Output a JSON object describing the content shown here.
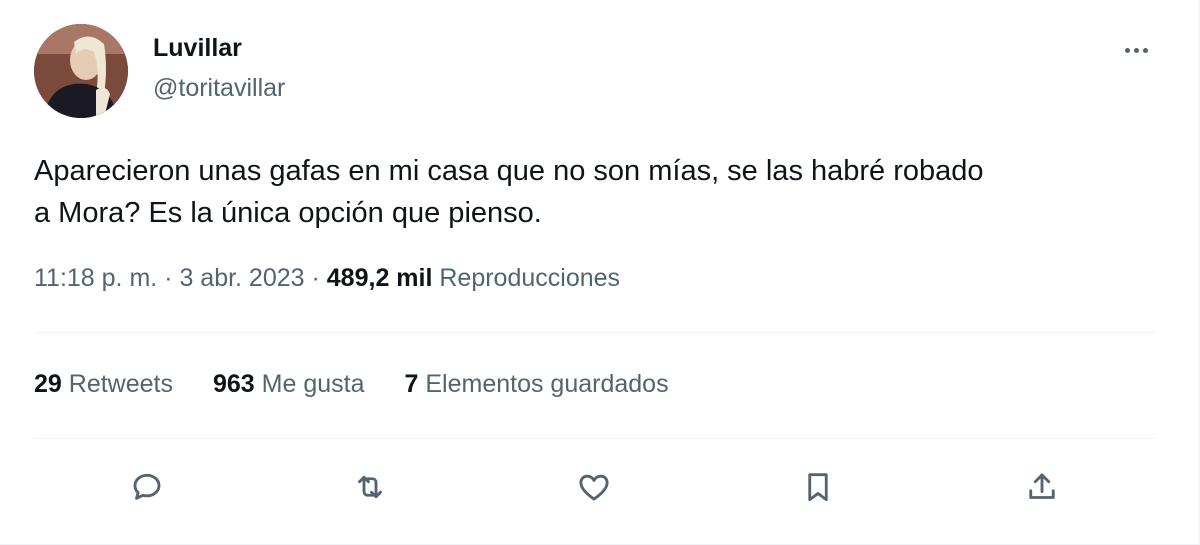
{
  "author": {
    "display_name": "Luvillar",
    "handle": "@toritavillar",
    "avatar_icon": "profile-photo"
  },
  "tweet": {
    "text": "Aparecieron unas gafas en mi casa que no son mías, se las habré robado\na Mora? Es la única opción que pienso."
  },
  "meta": {
    "time": "11:18 p. m.",
    "sep1": " · ",
    "date": "3 abr. 2023",
    "sep2": " · ",
    "views_count": "489,2 mil",
    "views_label": "Reproducciones"
  },
  "stats": {
    "retweets_count": "29",
    "retweets_label": "Retweets",
    "likes_count": "963",
    "likes_label": "Me gusta",
    "bookmarks_count": "7",
    "bookmarks_label": "Elementos guardados"
  },
  "actions": [
    {
      "icon": "reply-icon"
    },
    {
      "icon": "retweet-icon"
    },
    {
      "icon": "like-heart-icon"
    },
    {
      "icon": "bookmark-icon"
    },
    {
      "icon": "share-icon"
    }
  ],
  "colors": {
    "primary_text": "#0f1419",
    "secondary_text": "#536471",
    "divider": "#eff3f4"
  }
}
